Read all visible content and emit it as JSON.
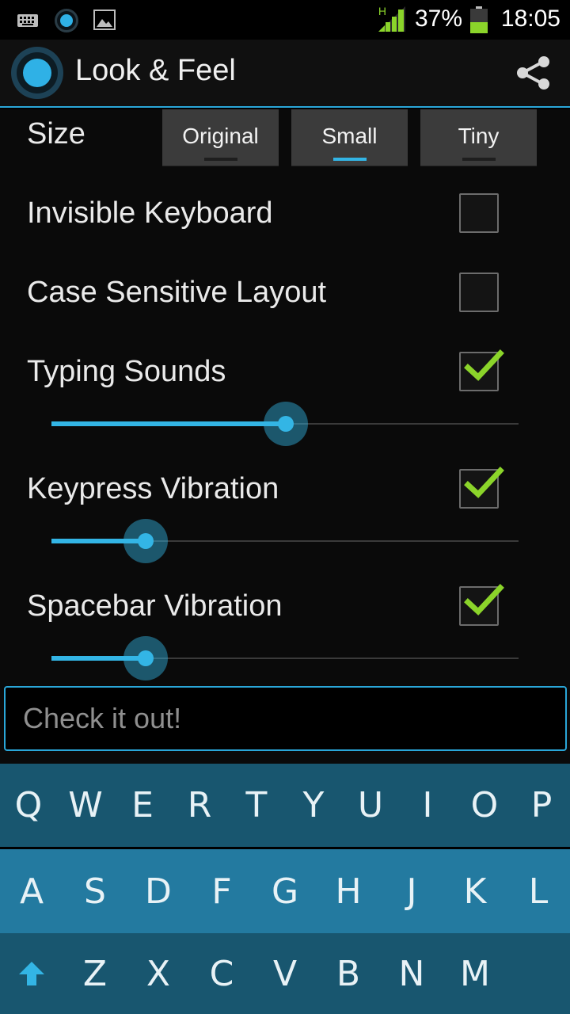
{
  "status_bar": {
    "icons": [
      "keyboard-icon",
      "app-notification-icon",
      "image-icon"
    ],
    "network_type": "H",
    "battery_percent": "37%",
    "time": "18:05"
  },
  "action_bar": {
    "title": "Look & Feel",
    "share_icon": "share-icon"
  },
  "settings": {
    "size": {
      "label": "Size",
      "options": [
        "Original",
        "Small",
        "Tiny"
      ],
      "selected": "Small"
    },
    "invisible_keyboard": {
      "label": "Invisible Keyboard",
      "checked": false
    },
    "case_sensitive_layout": {
      "label": "Case Sensitive Layout",
      "checked": false
    },
    "typing_sounds": {
      "label": "Typing Sounds",
      "checked": true,
      "level": 0.5
    },
    "keypress_vibration": {
      "label": "Keypress Vibration",
      "checked": true,
      "level": 0.2
    },
    "spacebar_vibration": {
      "label": "Spacebar Vibration",
      "checked": true,
      "level": 0.2
    }
  },
  "text_field": {
    "placeholder": "Check it out!",
    "value": ""
  },
  "keyboard": {
    "row1": [
      "Q",
      "W",
      "E",
      "R",
      "T",
      "Y",
      "U",
      "I",
      "O",
      "P"
    ],
    "row2": [
      "A",
      "S",
      "D",
      "F",
      "G",
      "H",
      "J",
      "K",
      "L"
    ],
    "row3": [
      "Z",
      "X",
      "C",
      "V",
      "B",
      "N",
      "M"
    ],
    "shift_icon": "shift-arrow-icon",
    "colors": {
      "dark_row": "#18566f",
      "light_row": "#237aa0"
    }
  },
  "colors": {
    "accent": "#33b5e5",
    "check": "#8bd42a"
  }
}
